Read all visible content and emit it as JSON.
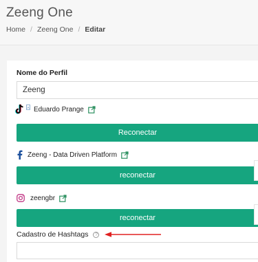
{
  "header": {
    "title": "Zeeng One",
    "breadcrumb": {
      "home": "Home",
      "parent": "Zeeng One",
      "current": "Editar",
      "separator": "/"
    }
  },
  "form": {
    "profile_name_label": "Nome do Perfil",
    "profile_name_value": "Zeeng",
    "hashtags_label": "Cadastro de Hashtags",
    "hashtags_help_icon": "?",
    "hashtags_value": ""
  },
  "accounts": [
    {
      "network": "tiktok",
      "icon": "tiktok-icon",
      "name": "Eduardo Prange",
      "button_label": "Reconectar"
    },
    {
      "network": "facebook",
      "icon": "facebook-icon",
      "name": "Zeeng - Data Driven Platform",
      "button_label": "reconectar"
    },
    {
      "network": "instagram",
      "icon": "instagram-icon",
      "name": "zeengbr",
      "button_label": "reconectar"
    }
  ],
  "colors": {
    "accent": "#16a57f",
    "link": "#2a8f5e",
    "facebook": "#1b4f9c",
    "instagram": "#c13584",
    "arrow": "#e02020"
  }
}
